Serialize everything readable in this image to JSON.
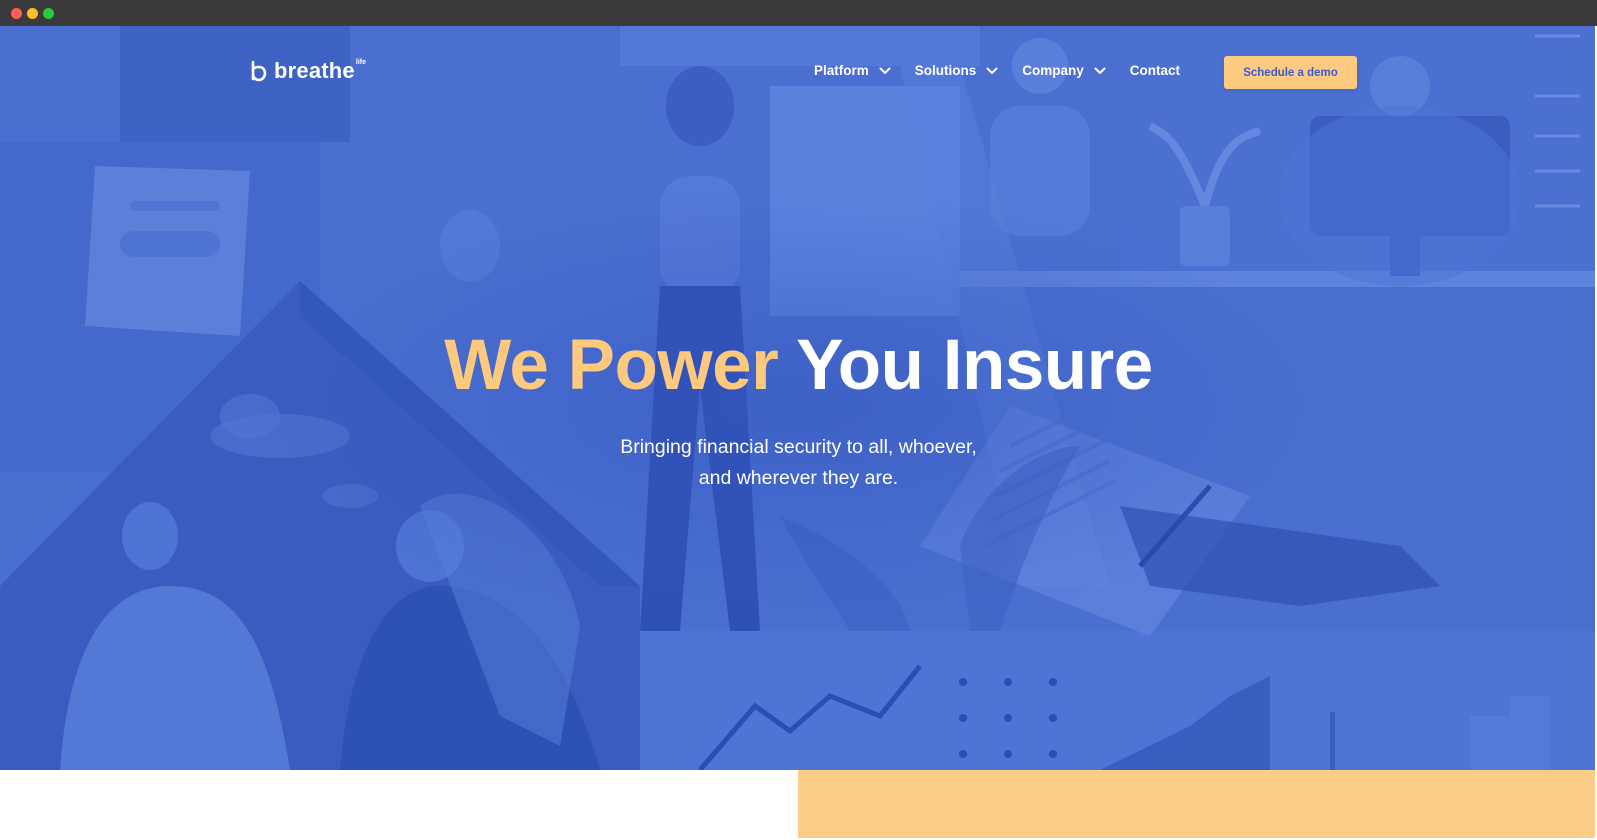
{
  "brand": {
    "name": "breathe",
    "superscript": "life"
  },
  "nav": {
    "items": [
      {
        "label": "Platform",
        "has_dropdown": true
      },
      {
        "label": "Solutions",
        "has_dropdown": true
      },
      {
        "label": "Company",
        "has_dropdown": true
      },
      {
        "label": "Contact",
        "has_dropdown": false
      }
    ],
    "cta_label": "Schedule a demo"
  },
  "hero": {
    "headline_accent": "We Power",
    "headline_rest": "You Insure",
    "subtitle_line1": "Bringing financial security to all, whoever,",
    "subtitle_line2": "and wherever they are."
  },
  "colors": {
    "hero_blue": "#4a6fd0",
    "accent_yellow": "#fccb81",
    "cta_text": "#3b5bd3",
    "white": "#ffffff"
  },
  "icons": {
    "dropdown": "chevron-down-icon",
    "logo": "breathe-logo-icon"
  }
}
